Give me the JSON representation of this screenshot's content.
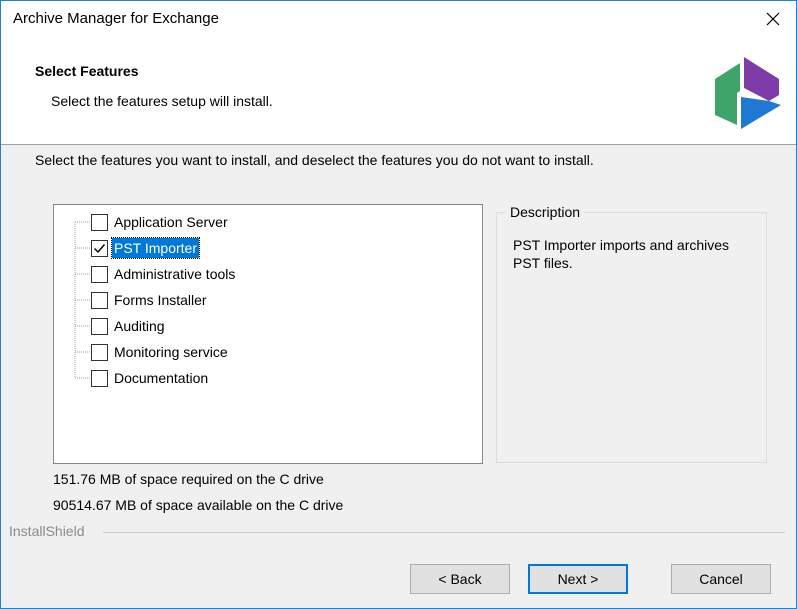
{
  "window": {
    "title": "Archive Manager for Exchange"
  },
  "header": {
    "title": "Select Features",
    "subtitle": "Select the features setup will install."
  },
  "instruction": "Select the features you want to install, and deselect the features you do not want to install.",
  "features": [
    {
      "label": "Application Server",
      "checked": false,
      "selected": false
    },
    {
      "label": "PST Importer",
      "checked": true,
      "selected": true
    },
    {
      "label": "Administrative tools",
      "checked": false,
      "selected": false
    },
    {
      "label": "Forms Installer",
      "checked": false,
      "selected": false
    },
    {
      "label": "Auditing",
      "checked": false,
      "selected": false
    },
    {
      "label": "Monitoring service",
      "checked": false,
      "selected": false
    },
    {
      "label": "Documentation",
      "checked": false,
      "selected": false
    }
  ],
  "description": {
    "legend": "Description",
    "text": "PST Importer imports and archives PST files."
  },
  "space": {
    "required": "151.76 MB of space required on the C drive",
    "available": "90514.67 MB of space available on the C drive"
  },
  "footer": {
    "brand": "InstallShield"
  },
  "buttons": {
    "back": "< Back",
    "next": "Next >",
    "cancel": "Cancel"
  },
  "colors": {
    "accent": "#0078d7",
    "logo_green": "#3fa46a",
    "logo_purple": "#7d3ca8",
    "logo_blue": "#1f78d1"
  }
}
